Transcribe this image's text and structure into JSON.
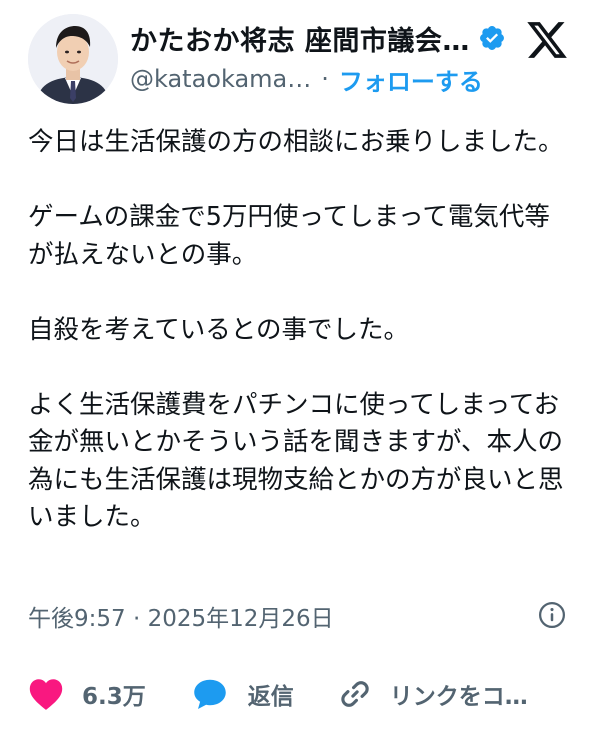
{
  "author": {
    "display_name": "かたおか将志 座間市議会…",
    "handle": "@kataokama…",
    "separator": "·",
    "follow_label": "フォローする",
    "verified_color": "#1d9bf0"
  },
  "tweet": {
    "text": "今日は生活保護の方の相談にお乗りしました。\n\nゲームの課金で5万円使ってしまって電気代等が払えないとの事。\n\n自殺を考えているとの事でした。\n\nよく生活保護費をパチンコに使ってしまってお金が無いとかそういう話を聞きますが、本人の為にも生活保護は現物支給とかの方が良いと思いました。",
    "timestamp": "午後9:57 · 2025年12月26日"
  },
  "actions": {
    "like_count": "6.3万",
    "reply_label": "返信",
    "copy_link_label": "リンクをコ…"
  },
  "colors": {
    "text": "#0f1419",
    "secondary": "#536471",
    "accent": "#1d9bf0",
    "like": "#f91880"
  },
  "icons": [
    "x-logo-icon",
    "verified-badge-icon",
    "info-icon",
    "heart-icon",
    "reply-bubble-icon",
    "link-icon"
  ]
}
